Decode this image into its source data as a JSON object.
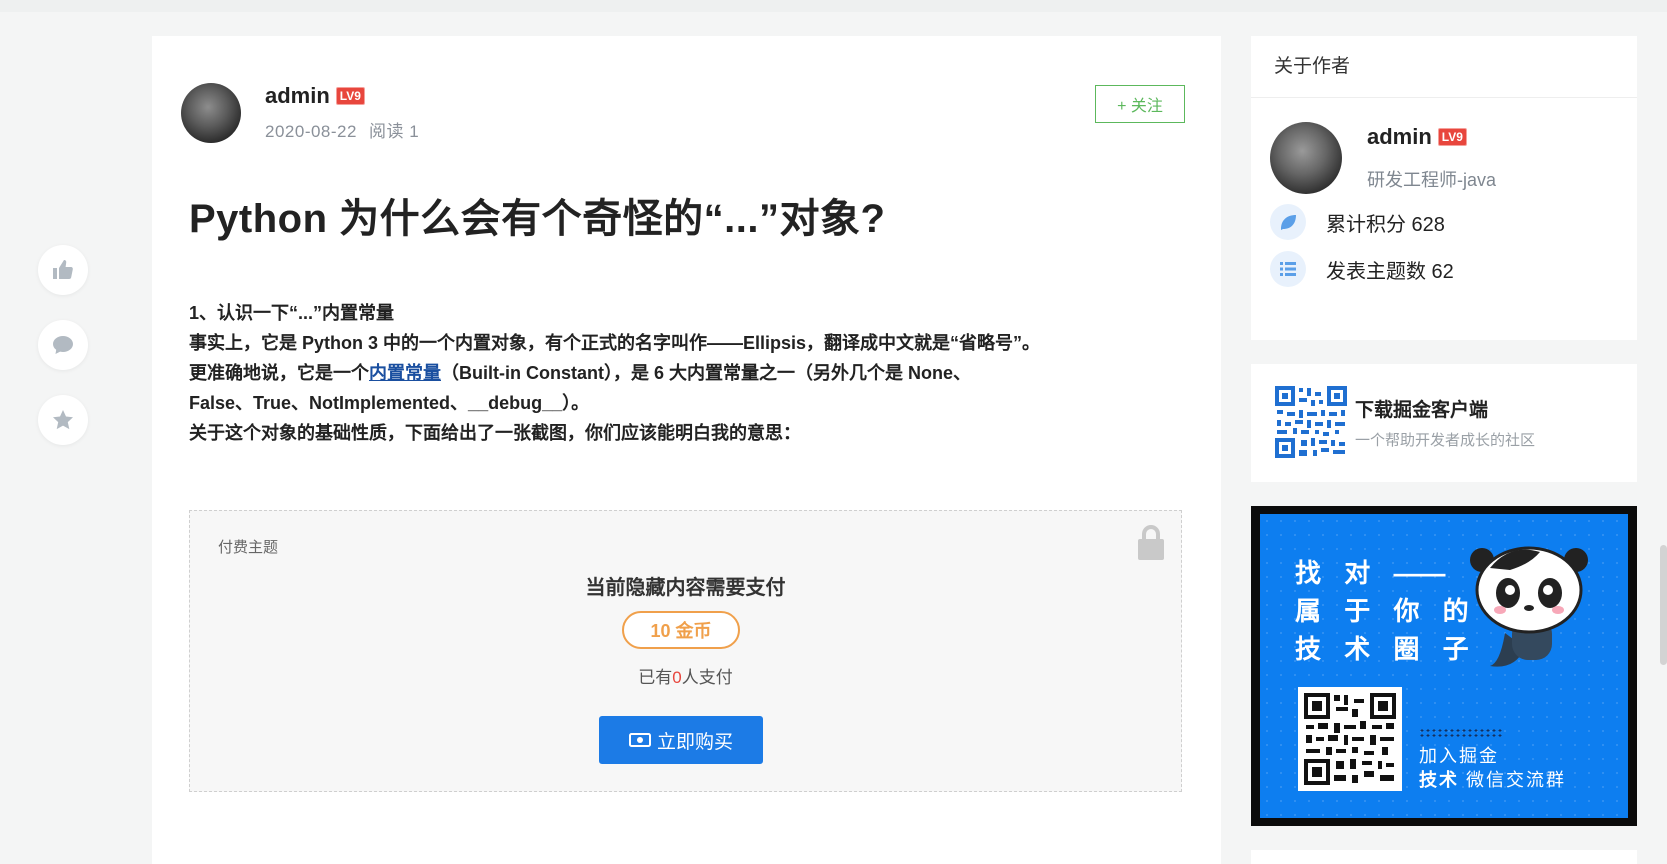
{
  "actions": {
    "like_icon": "thumbs-up-icon",
    "comment_icon": "comment-icon",
    "favorite_icon": "star-icon"
  },
  "post": {
    "author": "admin",
    "level": "LV9",
    "date": "2020-08-22",
    "reads_label": "阅读 1",
    "follow_label": "+ 关注",
    "title": "Python 为什么会有个奇怪的“...”对象?",
    "body": {
      "line1": "1、认识一下“...”内置常量",
      "line2": "事实上，它是 Python 3 中的一个内置对象，有个正式的名字叫作——Ellipsis，翻译成中文就是“省略号”。",
      "line3_before": "更准确地说，它是一个",
      "line3_link": "内置常量",
      "line3_after": "（Built-in Constant），是 6 大内置常量之一（另外几个是 None、",
      "line4": "False、True、NotImplemented、__debug__）。",
      "line5": "关于这个对象的基础性质，下面给出了一张截图，你们应该能明白我的意思："
    },
    "paywall": {
      "label": "付费主题",
      "heading": "当前隐藏内容需要支付",
      "price": "10 金币",
      "paid_prefix": "已有",
      "paid_count": "0",
      "paid_suffix": "人支付",
      "buy_label": "立即购买"
    }
  },
  "sidebar": {
    "about": {
      "heading": "关于作者",
      "name": "admin",
      "level": "LV9",
      "role": "研发工程师-java",
      "points_label": "累计积分 628",
      "topics_label": "发表主题数 62"
    },
    "app": {
      "title": "下载掘金客户端",
      "subtitle": "一个帮助开发者成长的社区"
    },
    "banner": {
      "line1": "找 对",
      "dash": "——",
      "line2": "属 于 你 的",
      "line3": "技 术 圈 子",
      "join1": "加入掘金",
      "join2_bold": "技术",
      "join2_rest": "微信交流群"
    }
  },
  "colors": {
    "accent": "#1c7be6",
    "follow": "#5cb85c",
    "badge": "#e8463d",
    "price": "#f0a04b"
  }
}
